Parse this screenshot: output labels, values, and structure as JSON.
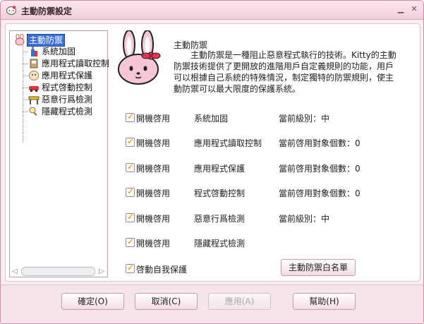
{
  "window": {
    "title": "主動防禦設定"
  },
  "tree": {
    "root": "主動防禦",
    "items": [
      "系統加固",
      "應用程式讀取控制",
      "應用程式保護",
      "程式啓動控制",
      "惡意行爲檢測",
      "隱藏程式檢測"
    ]
  },
  "description": {
    "title": "主動防禦",
    "body": "主動防禦是一種阻止惡意程式執行的技術。Kitty的主動防禦技術提供了更開放的進階用戶自定義規則的功能，用戶可以根據自己系統的特殊情況，制定獨特的防禦規則，使主動防禦可以最大限度的保護系統。"
  },
  "rows": [
    {
      "checkbox": "開機啓用",
      "name": "系統加固",
      "status": "當前級別：中",
      "checked": true
    },
    {
      "checkbox": "開機啓用",
      "name": "應用程式讀取控制",
      "status": "當前啓用對象個數：0",
      "checked": true
    },
    {
      "checkbox": "開機啓用",
      "name": "應用程式保護",
      "status": "當前啓用對象個數：0",
      "checked": true
    },
    {
      "checkbox": "開機啓用",
      "name": "程式啓動控制",
      "status": "當前啓用對象個數：0",
      "checked": true
    },
    {
      "checkbox": "開機啓用",
      "name": "惡意行爲檢測",
      "status": "當前級別：中",
      "checked": true
    },
    {
      "checkbox": "開機啓用",
      "name": "隱藏程式檢測",
      "status": "",
      "checked": true
    }
  ],
  "self_protect": {
    "label": "啓動自我保護",
    "checked": true
  },
  "whitelist_button": "主動防禦白名單",
  "buttons": {
    "ok": "確定(O)",
    "cancel": "取消(C)",
    "apply": "應用(A)",
    "help": "幫助(H)"
  },
  "colors": {
    "accent_pink": "#f1cfdb",
    "selection_blue": "#3a6fd8",
    "checkmark_orange": "#e08a00"
  }
}
